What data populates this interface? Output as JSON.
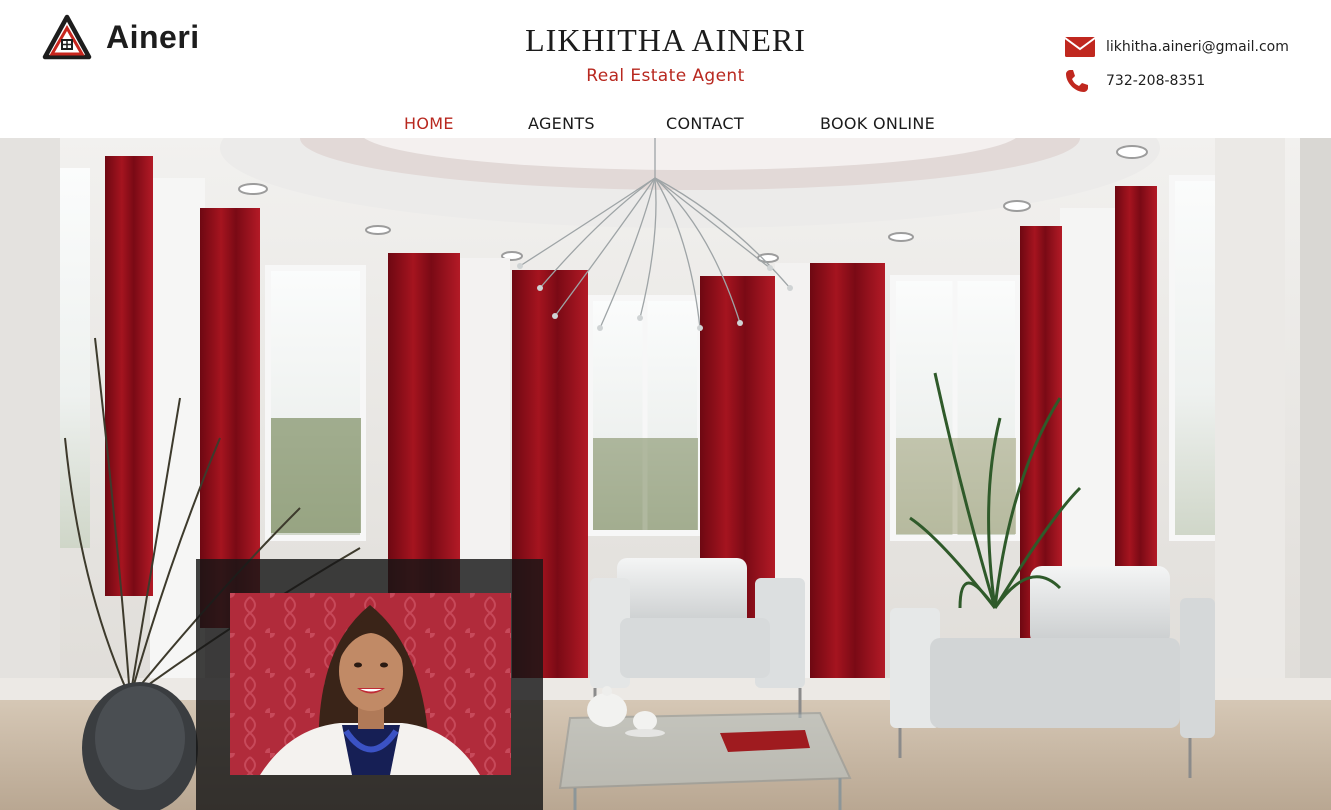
{
  "brand": {
    "logo_text": "Aineri"
  },
  "header": {
    "title": "LIKHITHA AINERI",
    "subtitle": "Real Estate Agent"
  },
  "contact": {
    "email": "likhitha.aineri@gmail.com",
    "phone": "732-208-8351",
    "email_icon": "envelope-icon",
    "phone_icon": "phone-icon"
  },
  "nav": {
    "items": [
      {
        "label": "HOME",
        "active": true
      },
      {
        "label": "AGENTS",
        "active": false
      },
      {
        "label": "CONTACT",
        "active": false
      },
      {
        "label": "BOOK ONLINE",
        "active": false
      }
    ]
  },
  "colors": {
    "accent": "#b8281f",
    "curtain": "#8e0f1c",
    "text": "#1b1b1b"
  }
}
